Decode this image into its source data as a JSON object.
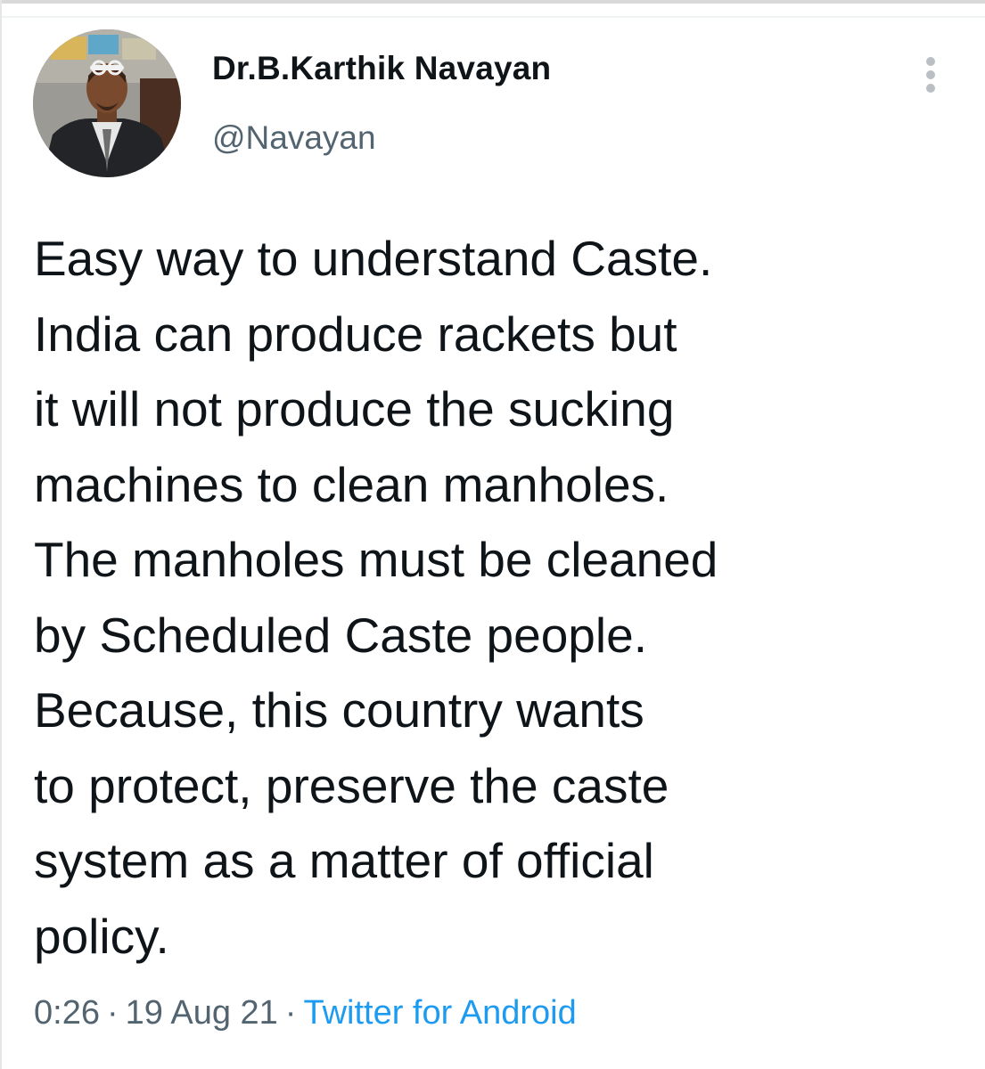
{
  "tweet": {
    "author": {
      "name": "Dr.B.Karthik Navayan",
      "handle": "@Navayan"
    },
    "text_lines": [
      "Easy way to understand Caste.",
      "India can produce rackets but",
      "it will not produce the sucking",
      "machines to clean manholes.",
      "The manholes must be cleaned",
      "by Scheduled Caste people.",
      "Because, this country wants",
      "to protect, preserve the caste",
      "system as a matter of official",
      "policy."
    ],
    "time": "0:26",
    "date": "19 Aug 21",
    "separator": "·",
    "source": "Twitter for Android"
  },
  "icons": {
    "more": "more-vertical-icon"
  },
  "colors": {
    "text": "#0f1419",
    "secondary": "#536471",
    "link": "#1d9bf0",
    "background": "#ffffff"
  }
}
